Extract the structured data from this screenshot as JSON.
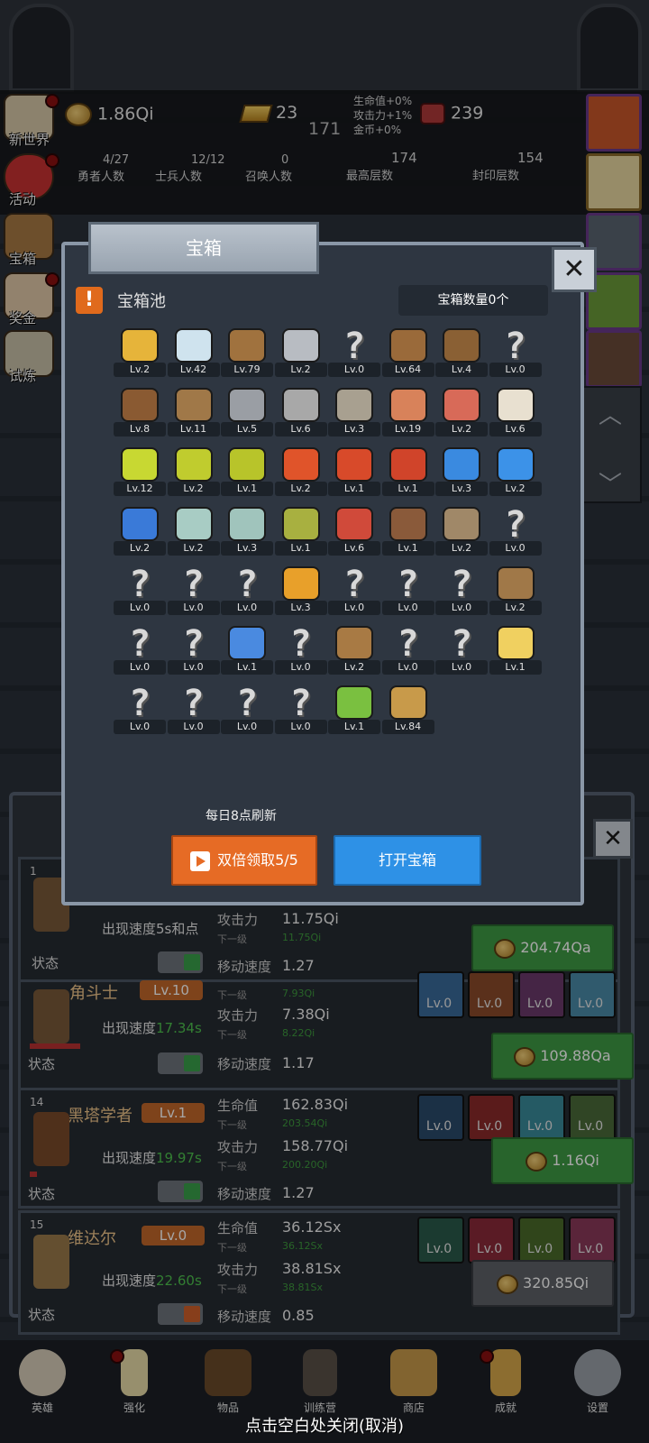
{
  "hud": {
    "coins": "1.86Qi",
    "gold_bar": "23",
    "gems": "239",
    "center_value": "171",
    "bonuses": [
      "生命值+0%",
      "攻击力+1%",
      "金币+0%"
    ],
    "hero_count": {
      "value": "4/27",
      "label": "勇者人数"
    },
    "soldier_count": {
      "value": "12/12",
      "label": "士兵人数"
    },
    "summon_count": {
      "value": "0",
      "label": "召唤人数"
    },
    "max_floor": {
      "value": "174",
      "label": "最高层数"
    },
    "seal_floor": {
      "value": "154",
      "label": "封印层数"
    }
  },
  "side_menu": [
    "新世界",
    "活动",
    "宝箱",
    "奖金",
    "试炼"
  ],
  "heroes": [
    {
      "num": "1",
      "spawn_label": "出现速度",
      "spawn": "5s和点",
      "stat1_label": "攻击力",
      "stat1": "11.75Qi",
      "next_label": "下一级",
      "next1": "11.75Qi",
      "move_label": "移动速度",
      "move": "1.27",
      "state_label": "状态",
      "buy": "204.74Qa"
    },
    {
      "num": "",
      "name": "角斗士",
      "lv": "Lv.10",
      "spawn_label": "出现速度",
      "spawn": "17.34s",
      "stat0_next": "7.93Qi",
      "stat1_label": "攻击力",
      "stat1": "7.38Qi",
      "next_label": "下一级",
      "next1": "8.22Qi",
      "move_label": "移动速度",
      "move": "1.17",
      "state_label": "状态",
      "buy": "109.88Qa",
      "skills": [
        "Lv.0",
        "Lv.0",
        "Lv.0",
        "Lv.0"
      ]
    },
    {
      "num": "14",
      "name": "黑塔学者",
      "lv": "Lv.1",
      "spawn_label": "出现速度",
      "spawn": "19.97s",
      "stat0_label": "生命值",
      "stat0": "162.83Qi",
      "next0": "203.54Qi",
      "stat1_label": "攻击力",
      "stat1": "158.77Qi",
      "next_label": "下一级",
      "next1": "200.20Qi",
      "move_label": "移动速度",
      "move": "1.27",
      "state_label": "状态",
      "buy": "1.16Qi",
      "skills": [
        "Lv.0",
        "Lv.0",
        "Lv.0",
        "Lv.0"
      ]
    },
    {
      "num": "15",
      "name": "维达尔",
      "lv": "Lv.0",
      "spawn_label": "出现速度",
      "spawn": "22.60s",
      "stat0_label": "生命值",
      "stat0": "36.12Sx",
      "next0": "36.12Sx",
      "stat1_label": "攻击力",
      "stat1": "38.81Sx",
      "next_label": "下一级",
      "next1": "38.81Sx",
      "move_label": "移动速度",
      "move": "0.85",
      "state_label": "状态",
      "buy": "320.85Qi",
      "skills": [
        "Lv.0",
        "Lv.0",
        "Lv.0",
        "Lv.0"
      ]
    }
  ],
  "modal": {
    "title": "宝箱",
    "close": "✕",
    "warn": "!",
    "pool_label": "宝箱池",
    "count": "宝箱数量0个",
    "refresh": "每日8点刷新",
    "double_btn": "双倍领取5/5",
    "open_btn": "打开宝箱",
    "items": [
      {
        "icon": "crown-icon",
        "lv": "Lv.2",
        "c": "#e6b43a"
      },
      {
        "icon": "diamond-icon",
        "lv": "Lv.42",
        "c": "#cfe3ee"
      },
      {
        "icon": "wooden-sword-icon",
        "lv": "Lv.79",
        "c": "#a0723e"
      },
      {
        "icon": "iron-sword-icon",
        "lv": "Lv.2",
        "c": "#b8bcc2"
      },
      {
        "icon": "unknown-icon",
        "lv": "Lv.0",
        "q": true
      },
      {
        "icon": "leather-armor-icon",
        "lv": "Lv.64",
        "c": "#9a6a3a"
      },
      {
        "icon": "backpack-icon",
        "lv": "Lv.4",
        "c": "#8a6034"
      },
      {
        "icon": "unknown-icon",
        "lv": "Lv.0",
        "q": true
      },
      {
        "icon": "leather-helmet-icon",
        "lv": "Lv.8",
        "c": "#8a5a32"
      },
      {
        "icon": "dagger-icon",
        "lv": "Lv.11",
        "c": "#a07848"
      },
      {
        "icon": "knight-helmet-icon",
        "lv": "Lv.5",
        "c": "#9a9ea4"
      },
      {
        "icon": "hammer-icon",
        "lv": "Lv.6",
        "c": "#a8a8a8"
      },
      {
        "icon": "great-helm-icon",
        "lv": "Lv.3",
        "c": "#a8a090"
      },
      {
        "icon": "ham-icon",
        "lv": "Lv.19",
        "c": "#d8825a"
      },
      {
        "icon": "steak-icon",
        "lv": "Lv.2",
        "c": "#d86a58"
      },
      {
        "icon": "rice-bowl-icon",
        "lv": "Lv.6",
        "c": "#e8e0d0"
      },
      {
        "icon": "yellow-potion-icon",
        "lv": "Lv.12",
        "c": "#c8d832"
      },
      {
        "icon": "yellow-potion-icon",
        "lv": "Lv.2",
        "c": "#c0cc2e"
      },
      {
        "icon": "yellow-potion-icon",
        "lv": "Lv.1",
        "c": "#b8c42a"
      },
      {
        "icon": "red-potion-icon",
        "lv": "Lv.2",
        "c": "#e0542a"
      },
      {
        "icon": "red-potion-icon",
        "lv": "Lv.1",
        "c": "#d84a2a"
      },
      {
        "icon": "red-potion-icon",
        "lv": "Lv.1",
        "c": "#d0442a"
      },
      {
        "icon": "blue-potion-icon",
        "lv": "Lv.3",
        "c": "#3a8ae0"
      },
      {
        "icon": "blue-potion-icon",
        "lv": "Lv.2",
        "c": "#3c92e8"
      },
      {
        "icon": "blue-potion-icon",
        "lv": "Lv.2",
        "c": "#3a7ad8"
      },
      {
        "icon": "empty-bottle-icon",
        "lv": "Lv.2",
        "c": "#a8ccc4"
      },
      {
        "icon": "empty-bottle-icon",
        "lv": "Lv.3",
        "c": "#a0c4bc"
      },
      {
        "icon": "wine-bottle-icon",
        "lv": "Lv.1",
        "c": "#a8b040"
      },
      {
        "icon": "red-vial-icon",
        "lv": "Lv.6",
        "c": "#d04a3a"
      },
      {
        "icon": "boot-icon",
        "lv": "Lv.1",
        "c": "#8a5a3a"
      },
      {
        "icon": "boot-icon",
        "lv": "Lv.2",
        "c": "#a08868"
      },
      {
        "icon": "unknown-icon",
        "lv": "Lv.0",
        "q": true
      },
      {
        "icon": "unknown-icon",
        "lv": "Lv.0",
        "q": true
      },
      {
        "icon": "unknown-icon",
        "lv": "Lv.0",
        "q": true
      },
      {
        "icon": "unknown-icon",
        "lv": "Lv.0",
        "q": true
      },
      {
        "icon": "torch-icon",
        "lv": "Lv.3",
        "c": "#e8a02a"
      },
      {
        "icon": "unknown-icon",
        "lv": "Lv.0",
        "q": true
      },
      {
        "icon": "unknown-icon",
        "lv": "Lv.0",
        "q": true
      },
      {
        "icon": "unknown-icon",
        "lv": "Lv.0",
        "q": true
      },
      {
        "icon": "staff-icon",
        "lv": "Lv.2",
        "c": "#a07848"
      },
      {
        "icon": "unknown-icon",
        "lv": "Lv.0",
        "q": true
      },
      {
        "icon": "unknown-icon",
        "lv": "Lv.0",
        "q": true
      },
      {
        "icon": "magic-wand-icon",
        "lv": "Lv.1",
        "c": "#4a8ae0"
      },
      {
        "icon": "unknown-icon",
        "lv": "Lv.0",
        "q": true
      },
      {
        "icon": "bag-icon",
        "lv": "Lv.2",
        "c": "#a87a44"
      },
      {
        "icon": "unknown-icon",
        "lv": "Lv.0",
        "q": true
      },
      {
        "icon": "unknown-icon",
        "lv": "Lv.0",
        "q": true
      },
      {
        "icon": "cheese-icon",
        "lv": "Lv.1",
        "c": "#f0d060"
      },
      {
        "icon": "unknown-icon",
        "lv": "Lv.0",
        "q": true
      },
      {
        "icon": "unknown-icon",
        "lv": "Lv.0",
        "q": true
      },
      {
        "icon": "unknown-icon",
        "lv": "Lv.0",
        "q": true
      },
      {
        "icon": "unknown-icon",
        "lv": "Lv.0",
        "q": true
      },
      {
        "icon": "green-wand-icon",
        "lv": "Lv.1",
        "c": "#7ac040"
      },
      {
        "icon": "beer-mug-icon",
        "lv": "Lv.84",
        "c": "#c89a4a"
      }
    ]
  },
  "bottom_nav": [
    "英雄",
    "强化",
    "物品",
    "训练营",
    "商店",
    "成就",
    "设置"
  ],
  "close_hint": "点击空白处关闭(取消)"
}
